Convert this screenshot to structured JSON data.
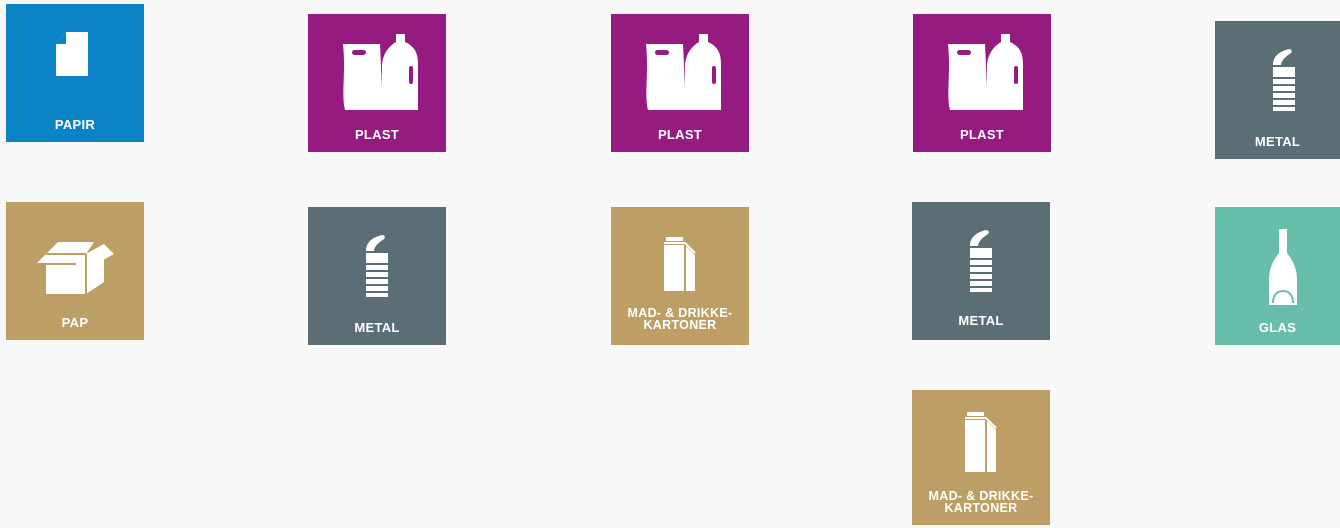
{
  "colors": {
    "papir": "#0a84c4",
    "plast": "#951b80",
    "metal": "#5b6e76",
    "pap": "#bd9e64",
    "mad": "#bd9e64",
    "glas": "#67bfa9"
  },
  "tiles": [
    {
      "category": "papir",
      "icon": "paper-icon",
      "label": "PAPIR"
    },
    {
      "category": "plast",
      "icon": "plastic-bag-bottle-icon",
      "label": "PLAST"
    },
    {
      "category": "plast",
      "icon": "plastic-bag-bottle-icon",
      "label": "PLAST"
    },
    {
      "category": "plast",
      "icon": "plastic-bag-bottle-icon",
      "label": "PLAST"
    },
    {
      "category": "metal",
      "icon": "can-icon",
      "label": "METAL"
    },
    {
      "category": "pap",
      "icon": "cardboard-box-icon",
      "label": "PAP"
    },
    {
      "category": "metal",
      "icon": "can-icon",
      "label": "METAL"
    },
    {
      "category": "mad",
      "icon": "carton-icon",
      "label_line1": "MAD- & DRIKKE-",
      "label_line2": "KARTONER"
    },
    {
      "category": "metal",
      "icon": "can-icon",
      "label": "METAL"
    },
    {
      "category": "glas",
      "icon": "glass-bottle-icon",
      "label": "GLAS"
    },
    {
      "category": "mad",
      "icon": "carton-icon",
      "label_line1": "MAD- & DRIKKE-",
      "label_line2": "KARTONER"
    }
  ]
}
